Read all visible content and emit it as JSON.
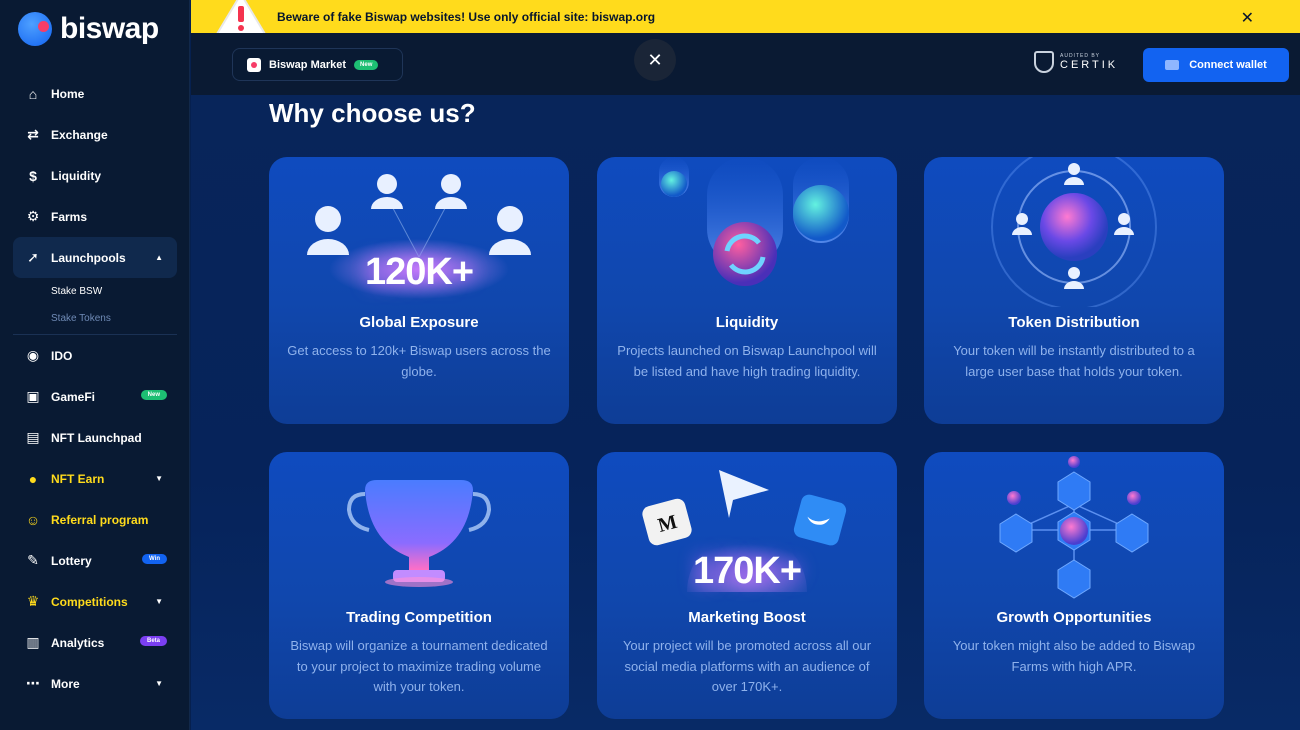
{
  "brand": {
    "name": "biswap"
  },
  "sidebar": {
    "items": [
      {
        "label": "Home",
        "icon": "home-icon"
      },
      {
        "label": "Exchange",
        "icon": "exchange-icon"
      },
      {
        "label": "Liquidity",
        "icon": "liquidity-icon"
      },
      {
        "label": "Farms",
        "icon": "farms-icon"
      },
      {
        "label": "Launchpools",
        "icon": "rocket-icon",
        "expanded": true
      },
      {
        "label": "IDO",
        "icon": "ido-icon"
      },
      {
        "label": "GameFi",
        "icon": "gamepad-icon",
        "badge": "New"
      },
      {
        "label": "NFT Launchpad",
        "icon": "nft-icon"
      },
      {
        "label": "NFT Earn",
        "icon": "nft-coins-icon",
        "color": "#ffdb1c"
      },
      {
        "label": "Referral program",
        "icon": "referral-icon",
        "color": "#ffdb1c"
      },
      {
        "label": "Lottery",
        "icon": "ticket-icon",
        "badge": "Win"
      },
      {
        "label": "Competitions",
        "icon": "trophy-icon",
        "color": "#ffdb1c"
      },
      {
        "label": "Analytics",
        "icon": "chart-icon",
        "badge": "Beta"
      },
      {
        "label": "More",
        "icon": "more-icon"
      }
    ],
    "launchpool_sub": [
      "Stake BSW",
      "Stake Tokens"
    ]
  },
  "banner": {
    "text": "Beware of fake Biswap websites! Use only official site: biswap.org",
    "close": "✕"
  },
  "topbar": {
    "market_label": "Biswap Market",
    "market_badge": "New",
    "close": "✕",
    "certik_small": "AUDITED BY",
    "certik_big": "CERTIK",
    "connect_label": "Connect wallet"
  },
  "main": {
    "title": "Why choose us?",
    "cards": [
      {
        "title": "Global Exposure",
        "desc": "Get access to 120k+ Biswap users across the globe.",
        "art_text": "120K+"
      },
      {
        "title": "Liquidity",
        "desc": "Projects launched on Biswap Launchpool will be listed and have high trading liquidity."
      },
      {
        "title": "Token Distribution",
        "desc": "Your token will be instantly distributed to a large user base that holds your token."
      },
      {
        "title": "Trading Competition",
        "desc": "Biswap will organize a tournament dedicated to your project to maximize trading volume with your token."
      },
      {
        "title": "Marketing Boost",
        "desc": "Your project will be promoted across all our social media platforms with an audience of over 170K+.",
        "art_text": "170K+"
      },
      {
        "title": "Growth Opportunities",
        "desc": "Your token might also be added to Biswap Farms with high APR."
      }
    ]
  },
  "colors": {
    "accent": "#1263f1",
    "banner": "#ffdb1c",
    "highlight": "#ffdb1c"
  }
}
